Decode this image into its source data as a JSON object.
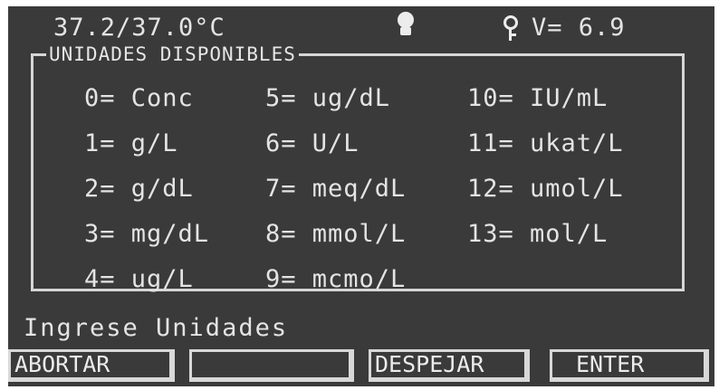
{
  "status_bar": {
    "temperature": "37.2/37.0°C",
    "voltage": "V= 6.9",
    "icons": [
      "lamp-icon",
      "key-icon"
    ]
  },
  "units_panel": {
    "title": "UNIDADES DISPONIBLES",
    "units": [
      "0= Conc",
      "1= g/L",
      "2= g/dL",
      "3= mg/dL",
      "4= ug/L",
      "5= ug/dL",
      "6= U/L",
      "7= meq/dL",
      "8= mmol/L",
      "9= mcmo/L",
      "10= IU/mL",
      "11= ukat/L",
      "12= umol/L",
      "13= mol/L"
    ]
  },
  "prompt": "Ingrese Unidades",
  "softkeys": {
    "abort": "ABORTAR",
    "blank": "",
    "clear": "DESPEJAR",
    "enter": "ENTER"
  },
  "colors": {
    "screen_background": "#3a3a3a",
    "foreground": "#e4e4e4"
  }
}
